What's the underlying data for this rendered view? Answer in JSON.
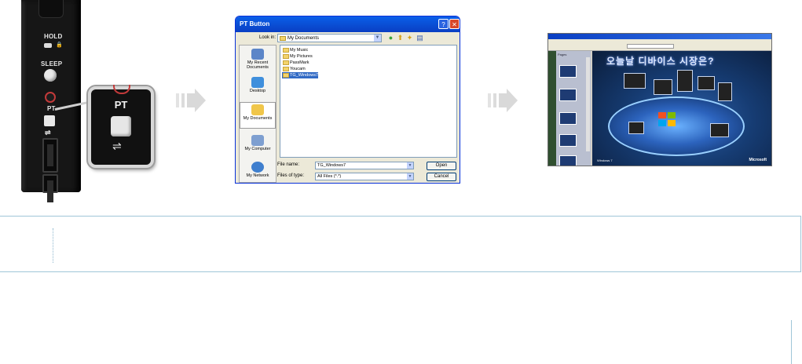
{
  "device": {
    "labels": {
      "hold": "HOLD",
      "sleep": "SLEEP",
      "pt": "PT"
    },
    "zoom_label": "PT",
    "usb_symbol": "⭠"
  },
  "dialog": {
    "title": "PT Button",
    "look_in_label": "Look in:",
    "look_in_value": "My Documents",
    "places": [
      {
        "label": "My Recent Documents"
      },
      {
        "label": "Desktop"
      },
      {
        "label": "My Documents"
      },
      {
        "label": "My Computer"
      },
      {
        "label": "My Network"
      }
    ],
    "files": [
      "My Music",
      "My Pictures",
      "PassMark",
      "Youcam",
      "TG_Windows7"
    ],
    "selected_file": "TG_Windows7",
    "file_name_label": "File name:",
    "file_name_value": "TG_Windows7",
    "file_type_label": "Files of type:",
    "file_type_value": "All Files (*.*)",
    "open_label": "Open",
    "cancel_label": "Cancel"
  },
  "presentation": {
    "slide_title": "오늘날 디바이스 시장은?",
    "pages_label": "Pages",
    "footer_left": "Windows 7",
    "footer_right": "Microsoft"
  },
  "colors": {
    "xp_blue": "#0a3fc3",
    "arrow": "#d9d9d9",
    "note_border": "#9fc6d8"
  }
}
